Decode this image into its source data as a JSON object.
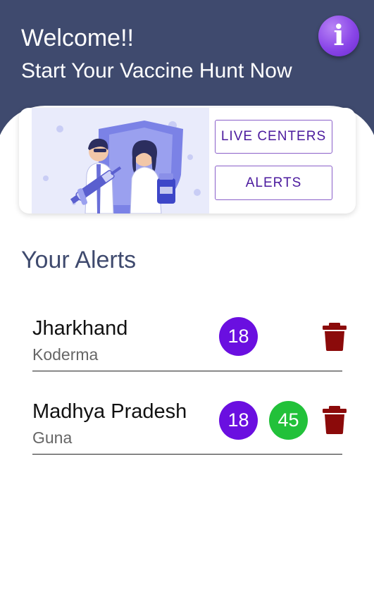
{
  "header": {
    "welcome": "Welcome!!",
    "subtitle": "Start Your Vaccine Hunt Now",
    "info_icon": "i"
  },
  "banner": {
    "live_centers_label": "LIVE CENTERS",
    "alerts_label": "ALERTS"
  },
  "section_title": "Your Alerts",
  "alerts": [
    {
      "state": "Jharkhand",
      "district": "Koderma",
      "ages": [
        "18"
      ]
    },
    {
      "state": "Madhya Pradesh",
      "district": "Guna",
      "ages": [
        "18",
        "45"
      ]
    }
  ],
  "colors": {
    "header_bg": "#3f4a6e",
    "age18_badge": "#6a0fe0",
    "age45_badge": "#22c13a",
    "delete_icon": "#8b0a0a",
    "button_text": "#4b1a9e"
  }
}
